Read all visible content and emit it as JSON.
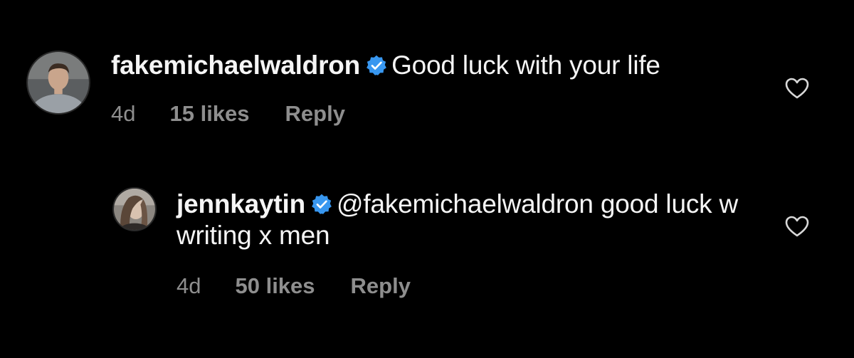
{
  "comments": [
    {
      "username": "fakemichaelwaldron",
      "verified": true,
      "text": "Good luck with your life",
      "age": "4d",
      "likes": "15 likes",
      "reply_label": "Reply",
      "avatar_icon": "profile-photo"
    },
    {
      "username": "jennkaytin",
      "verified": true,
      "text": "@fakemichaelwaldron good luck w writing x men",
      "age": "4d",
      "likes": "50 likes",
      "reply_label": "Reply",
      "avatar_icon": "profile-photo"
    }
  ],
  "icons": {
    "verified": "verified-badge-icon",
    "like": "heart-icon"
  },
  "colors": {
    "background": "#000000",
    "text": "#f5f5f5",
    "meta": "#8e8e8e",
    "verified": "#3897f0"
  }
}
